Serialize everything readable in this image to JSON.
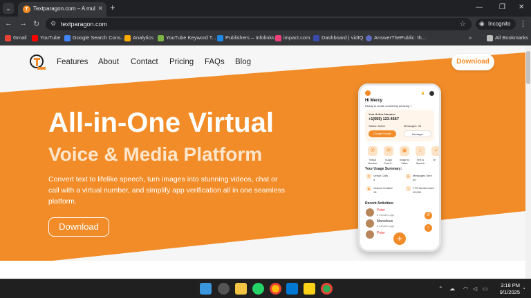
{
  "browser": {
    "tab_title": "Textparagon.com – A multipurp",
    "url": "textparagon.com",
    "incognito_label": "Incognito",
    "all_bookmarks": "All Bookmarks",
    "bookmarks": [
      {
        "label": "Gmail",
        "color": "#ea4335"
      },
      {
        "label": "YouTube",
        "color": "#ff0000"
      },
      {
        "label": "Google Search Cons...",
        "color": "#4285f4"
      },
      {
        "label": "Analytics",
        "color": "#f9ab00"
      },
      {
        "label": "YouTube Keyword T...",
        "color": "#7cb342"
      },
      {
        "label": "Publishers – Infolinks",
        "color": "#1e88e5"
      },
      {
        "label": "impact.com",
        "color": "#ec407a"
      },
      {
        "label": "Dashboard | vidIQ",
        "color": "#3949ab"
      },
      {
        "label": "AnswerThePublic: th...",
        "color": "#5c6bc0"
      }
    ]
  },
  "site": {
    "brand_color": "#f28c28",
    "nav": [
      "Features",
      "About",
      "Contact",
      "Pricing",
      "FAQs",
      "Blog"
    ],
    "download_label": "Download",
    "hero": {
      "title": "All-in-One Virtual",
      "subtitle": "Voice & Media Platform",
      "description": "Convert text to lifelike speech, turn images into stunning videos, chat or call with a virtual number, and simplify app verification all in one seamless platform.",
      "button": "Download"
    }
  },
  "phone": {
    "greeting": "Hi Mercy",
    "prompt": "Ready to create something amazing ?",
    "active_number_label": "Your Active Number:",
    "active_number": "+1(555) 123-4567",
    "status": "Status: Active",
    "messages": "Messages: 35",
    "change_number": "Change Number",
    "messages_btn": "Messages",
    "features": [
      {
        "label": "Virtual Number",
        "icon": "phone-icon"
      },
      {
        "label": "In-App Chat &...",
        "icon": "chat-icon"
      },
      {
        "label": "Image to Video",
        "icon": "image-icon"
      },
      {
        "label": "Text to Speech",
        "icon": "speech-icon"
      },
      {
        "label": "Ve",
        "icon": "verify-icon"
      }
    ],
    "usage_title": "Your Usage Summary:",
    "usage": [
      {
        "label": "Virtual Calls",
        "value": "3"
      },
      {
        "label": "Messages Sent",
        "value": "30"
      },
      {
        "label": "Videos Created",
        "value": "15"
      },
      {
        "label": "TTS Words Used",
        "value": "45,000"
      }
    ],
    "recent_title": "Recent Activities:",
    "activities": [
      {
        "name": "Peter",
        "time": "2 minutes ago",
        "color": "#e53935"
      },
      {
        "name": "Marvelous",
        "time": "3 minutes ago",
        "color": "#222222"
      },
      {
        "name": "Peter",
        "time": "",
        "color": "#e53935"
      }
    ]
  },
  "taskbar": {
    "time": "3:18 PM",
    "date": "9/1/2025"
  }
}
